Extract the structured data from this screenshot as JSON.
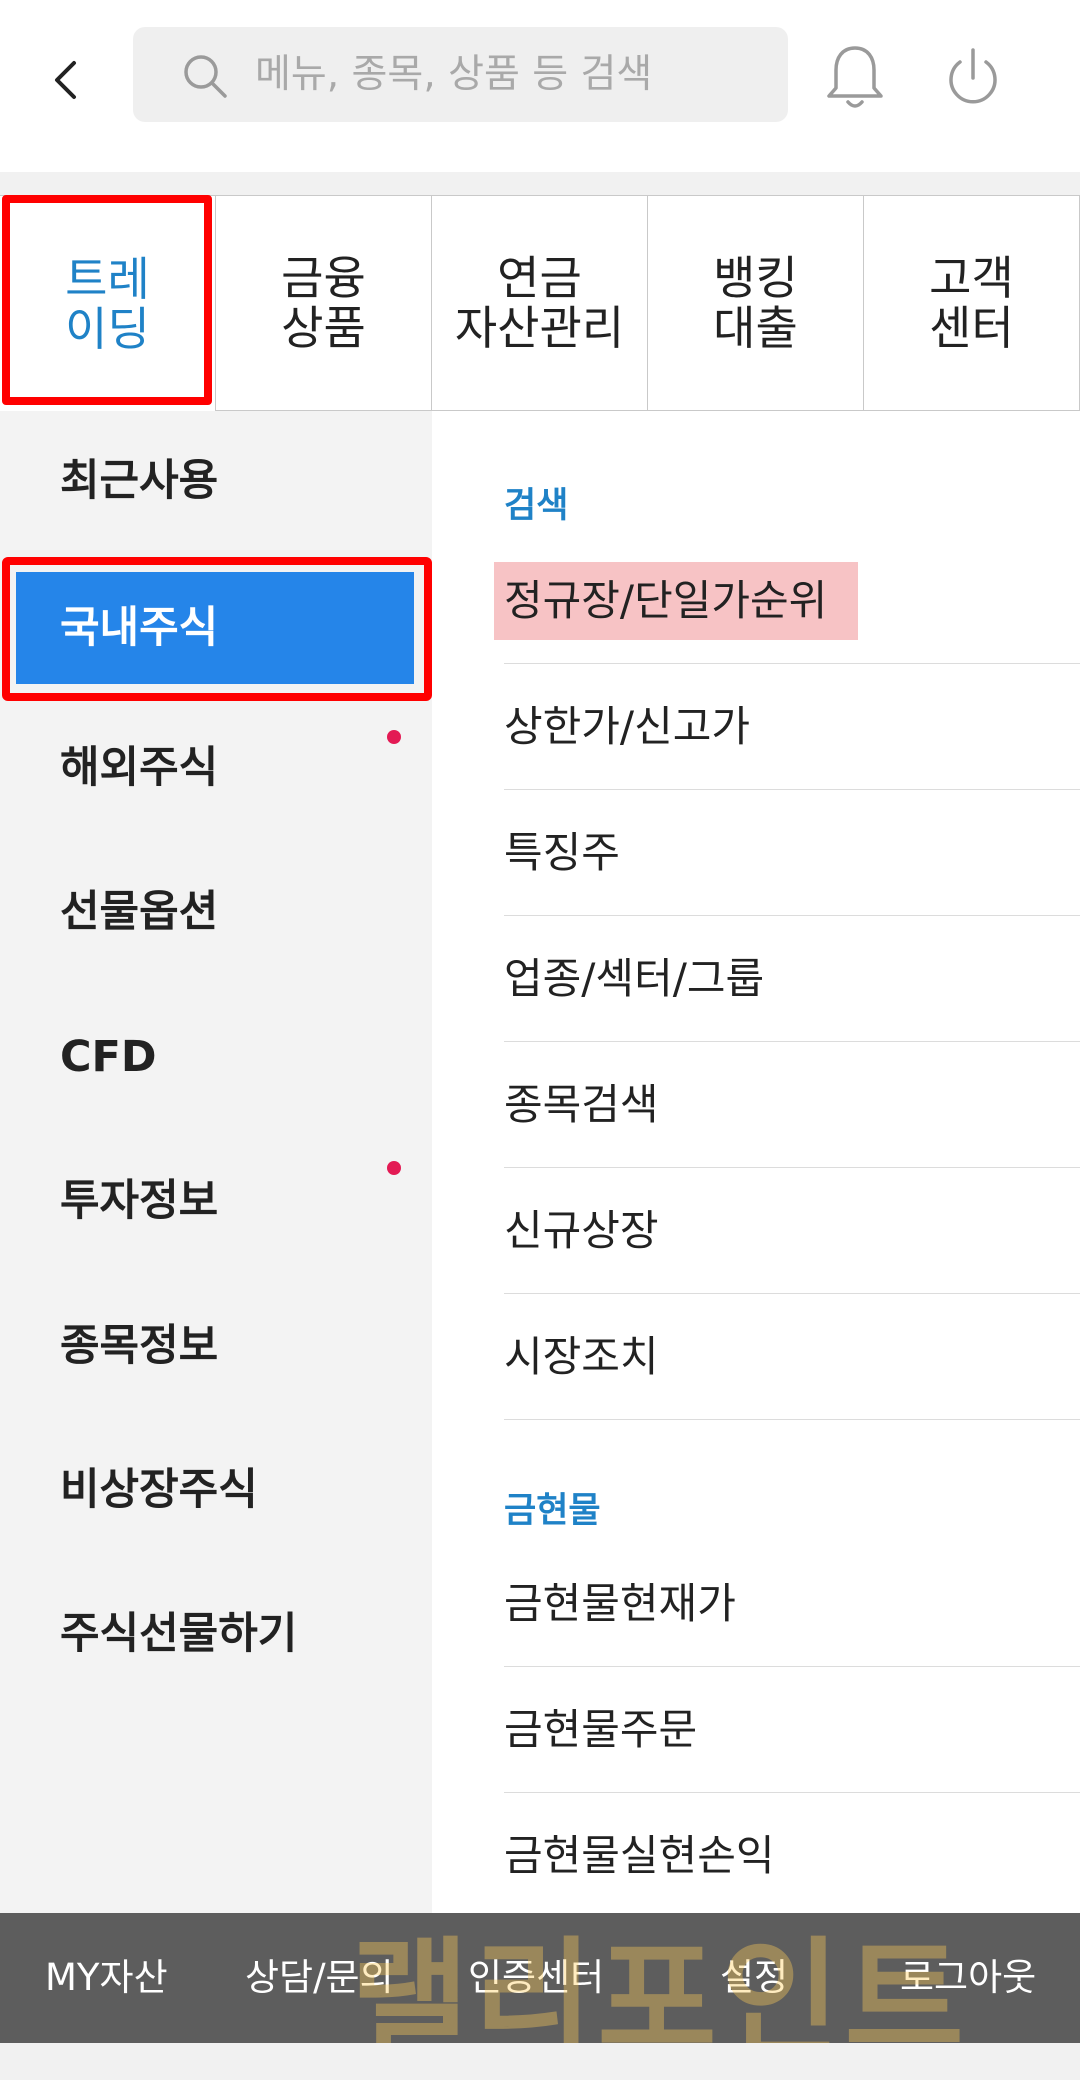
{
  "header": {
    "search_placeholder": "메뉴, 종목, 상품 등 검색"
  },
  "category_tabs": [
    {
      "label": "트레\n이딩",
      "active": true
    },
    {
      "label": "금융\n상품"
    },
    {
      "label": "연금\n자산관리"
    },
    {
      "label": "뱅킹\n대출"
    },
    {
      "label": "고객\n센터"
    }
  ],
  "sidebar": {
    "items": [
      {
        "label": "최근사용"
      },
      {
        "label": "국내주식",
        "active": true
      },
      {
        "label": "해외주식",
        "new_dot": true
      },
      {
        "label": "선물옵션"
      },
      {
        "label": "CFD"
      },
      {
        "label": "투자정보",
        "new_dot": true
      },
      {
        "label": "종목정보"
      },
      {
        "label": "비상장주식"
      },
      {
        "label": "주식선물하기"
      }
    ]
  },
  "content": {
    "sections": [
      {
        "title": "검색",
        "items": [
          "정규장/단일가순위",
          "상한가/신고가",
          "특징주",
          "업종/섹터/그룹",
          "종목검색",
          "신규상장",
          "시장조치"
        ]
      },
      {
        "title": "금현물",
        "items": [
          "금현물현재가",
          "금현물주문",
          "금현물실현손익"
        ]
      }
    ]
  },
  "bottom_bar": {
    "items": [
      "MY자산",
      "상담/문의",
      "인증센터",
      "설정",
      "로그아웃"
    ]
  },
  "watermark": "랠리포인트",
  "colors": {
    "accent_blue": "#1f82c7",
    "active_bg": "#2585e9",
    "highlight_red": "#ff0000",
    "dot_red": "#e31a54",
    "highlight_pink": "#f7c3c5"
  }
}
